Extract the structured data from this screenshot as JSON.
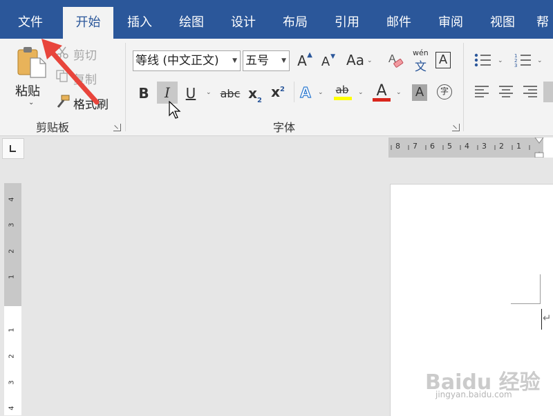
{
  "tabs": [
    "文件",
    "开始",
    "插入",
    "绘图",
    "设计",
    "布局",
    "引用",
    "邮件",
    "审阅",
    "视图",
    "帮"
  ],
  "active_tab": "开始",
  "clipboard": {
    "paste_label": "粘贴",
    "cut_label": "剪切",
    "copy_label": "复制",
    "format_painter_label": "格式刷",
    "group_label": "剪贴板"
  },
  "font": {
    "font_name": "等线 (中文正文)",
    "font_size": "五号",
    "group_label": "字体",
    "bold": "B",
    "italic": "I",
    "underline": "U",
    "strike": "abc",
    "subscript": "x",
    "subscript_mark": "2",
    "superscript": "x",
    "superscript_mark": "2",
    "grow": "A",
    "shrink": "A",
    "change_case": "Aa",
    "phonetic_top": "wén",
    "phonetic_bottom": "文",
    "char_border": "A",
    "text_effects": "A",
    "highlight": "ab",
    "font_color": "A",
    "char_shading": "A",
    "enclose": "字"
  },
  "ruler": {
    "h_numbers": [
      "8",
      "7",
      "6",
      "5",
      "4",
      "3",
      "2",
      "1"
    ],
    "v_numbers_top": [
      "4",
      "3",
      "2",
      "1"
    ],
    "v_numbers_bottom": [
      "1",
      "2",
      "3",
      "4"
    ]
  },
  "watermark": {
    "main": "Baidu 经验",
    "sub": "jingyan.baidu.com"
  },
  "colors": {
    "ribbon_blue": "#2b579a",
    "arrow_red": "#e8453c",
    "highlight_yellow": "#ffff00",
    "font_red": "#d9261c"
  }
}
